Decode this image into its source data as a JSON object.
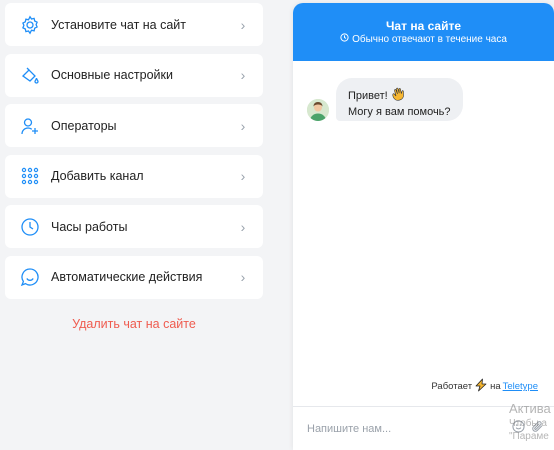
{
  "menu": {
    "items": [
      {
        "label": "Установите чат на сайт",
        "icon": "gear-icon"
      },
      {
        "label": "Основные настройки",
        "icon": "paint-bucket-icon"
      },
      {
        "label": "Операторы",
        "icon": "add-user-icon"
      },
      {
        "label": "Добавить канал",
        "icon": "grid-dots-icon"
      },
      {
        "label": "Часы работы",
        "icon": "clock-icon"
      },
      {
        "label": "Автоматические действия",
        "icon": "chat-smile-icon"
      }
    ],
    "chevron": "›",
    "delete_label": "Удалить чат на сайте"
  },
  "widget": {
    "title": "Чат на сайте",
    "subtitle": "Обычно отвечают в течение часа",
    "message_line1": "Привет!",
    "message_line2": "Могу я вам помочь?",
    "powered_prefix": "Работает",
    "powered_on": "на",
    "brand": "Teletype",
    "input_placeholder": "Напишите нам...",
    "colors": {
      "header": "#1f8ef7",
      "accent": "#1f8ef7",
      "danger": "#ef5b4f"
    }
  },
  "watermark": {
    "title": "Актива",
    "line1": "Чтобы а",
    "line2": "\"Параме"
  }
}
